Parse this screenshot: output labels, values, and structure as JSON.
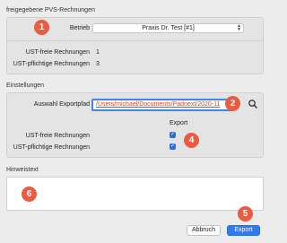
{
  "section1": {
    "title": "freigegebene PVS-Rechnungen",
    "betrieb_label": "Betrieb",
    "betrieb_value": "Praxis Dr. Test [#1]",
    "rows": [
      {
        "label": "UST-freie Rechnungen",
        "value": "1"
      },
      {
        "label": "UST-pflichtige Rechnungen",
        "value": "3"
      }
    ]
  },
  "section2": {
    "title": "Einstellungen",
    "export_path_label": "Auswahl Exportpfad",
    "export_path_value": "/Users/michael/Documents/Padnext/2020-11",
    "export_header": "Export",
    "checks": [
      {
        "label": "UST-freie Rechnungen",
        "checked": true
      },
      {
        "label": "UST-pflichtige Rechnungen",
        "checked": true
      }
    ]
  },
  "section3": {
    "title": "Hinweistext",
    "text": ""
  },
  "buttons": {
    "cancel": "Abbruch",
    "export": "Export"
  },
  "badges": [
    "1",
    "2",
    "4",
    "6",
    "5"
  ],
  "colors": {
    "badge": "#ea5b3f",
    "accent": "#2f7bf5",
    "path_text": "#e0402a"
  }
}
